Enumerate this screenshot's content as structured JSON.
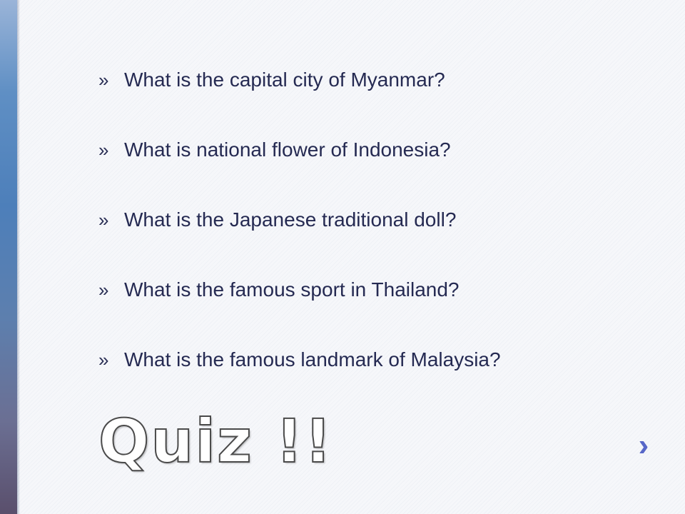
{
  "slide": {
    "bullet_symbol": "»",
    "questions": [
      "What is the capital city of Myanmar?",
      "What is national flower of Indonesia?",
      "What is the Japanese traditional doll?",
      "What is the famous sport in Thailand?",
      "What is the famous landmark of Malaysia?"
    ],
    "title": "Quiz !!",
    "next_glyph": "›"
  },
  "colors": {
    "text": "#252a52",
    "accent_bar": "#4d7fba",
    "arrow": "#5767c8"
  },
  "icons": {
    "next": "chevron-right-icon"
  }
}
